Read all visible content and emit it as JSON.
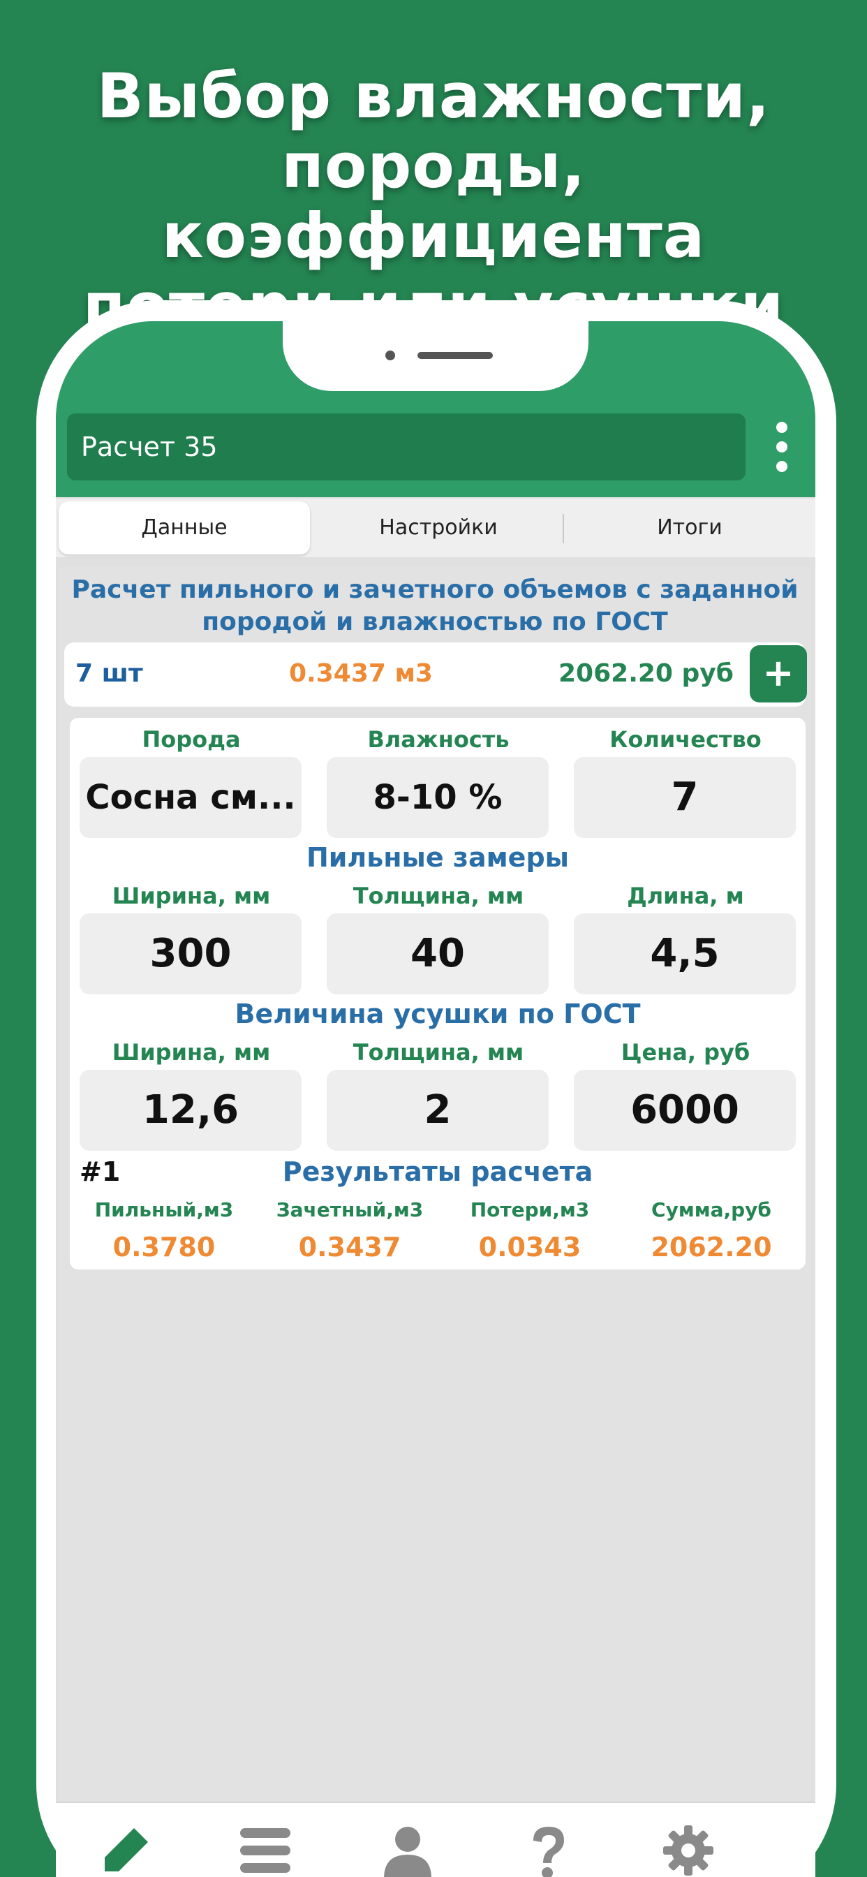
{
  "promo": {
    "line1": "Выбор влажности,",
    "line2": "породы, коэффициента",
    "line3": "потери или усушки"
  },
  "header": {
    "title": "Расчет 35"
  },
  "tabs": [
    {
      "label": "Данные",
      "active": true
    },
    {
      "label": "Настройки",
      "active": false
    },
    {
      "label": "Итоги",
      "active": false
    }
  ],
  "main": {
    "heading": "Расчет пильного и зачетного объемов с заданной породой и влажностью по ГОСТ",
    "summary": {
      "count": "7 шт",
      "volume": "0.3437 м3",
      "sum": "2062.20 руб",
      "add_label": "+"
    },
    "params": {
      "breed_label": "Порода",
      "breed_value": "Сосна см...",
      "humidity_label": "Влажность",
      "humidity_value": "8-10 %",
      "quantity_label": "Количество",
      "quantity_value": "7"
    },
    "saw_section_title": "Пильные замеры",
    "saw": {
      "width_label": "Ширина, мм",
      "width_value": "300",
      "thickness_label": "Толщина, мм",
      "thickness_value": "40",
      "length_label": "Длина, м",
      "length_value": "4,5"
    },
    "shrink_section_title": "Величина усушки по ГОСТ",
    "shrink": {
      "width_label": "Ширина, мм",
      "width_value": "12,6",
      "thickness_label": "Толщина, мм",
      "thickness_value": "2",
      "price_label": "Цена, руб",
      "price_value": "6000"
    },
    "results": {
      "index": "#1",
      "title": "Результаты расчета",
      "saw_label": "Пильный,м3",
      "saw_value": "0.3780",
      "credit_label": "Зачетный,м3",
      "credit_value": "0.3437",
      "loss_label": "Потери,м3",
      "loss_value": "0.0343",
      "sum_label": "Сумма,руб",
      "sum_value": "2062.20"
    }
  },
  "bottom_nav": [
    {
      "icon": "pencil-icon",
      "color": "#248552"
    },
    {
      "icon": "list-icon",
      "color": "#8a8a8a"
    },
    {
      "icon": "user-icon",
      "color": "#8a8a8a"
    },
    {
      "icon": "question-icon",
      "color": "#8a8a8a"
    },
    {
      "icon": "gear-icon",
      "color": "#8a8a8a"
    }
  ],
  "colors": {
    "background": "#248552",
    "header": "#2f9d68",
    "accent_blue": "#2a6ea8",
    "accent_orange": "#ef8a34",
    "accent_green": "#248552"
  }
}
